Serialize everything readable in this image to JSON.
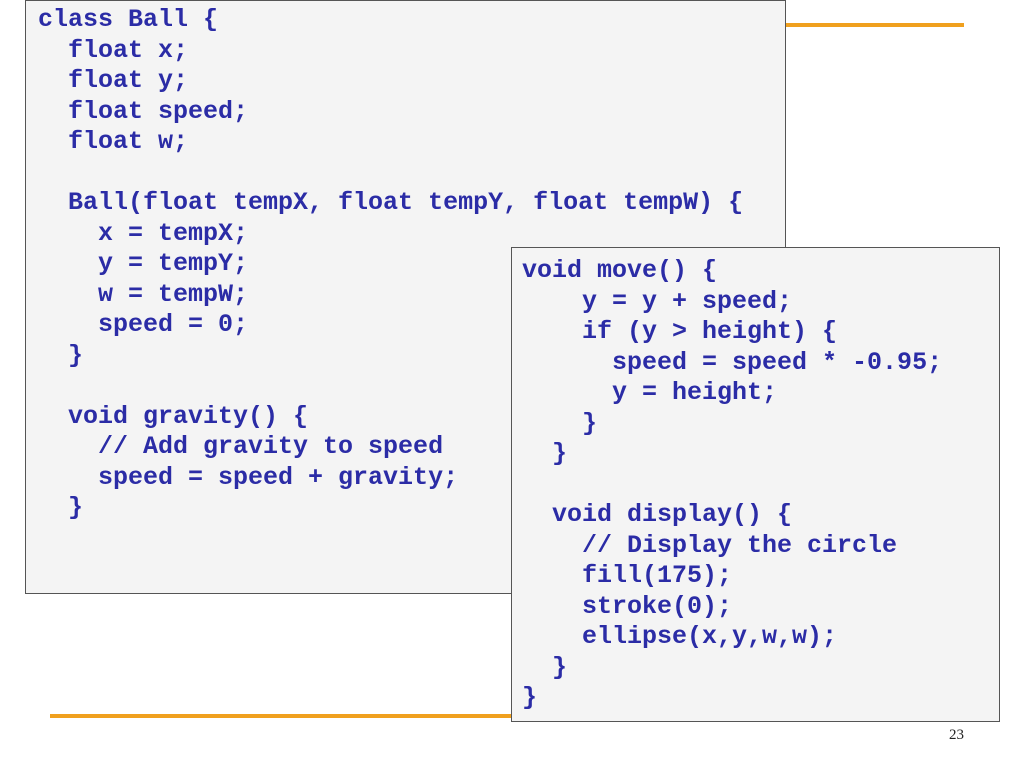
{
  "slide": {
    "page_number": "23",
    "accent_color": "#f0a01e",
    "code_color": "#2b2ca6",
    "box_background": "#f4f4f4"
  },
  "code_left": {
    "lines": [
      "class Ball {",
      "  float x;",
      "  float y;",
      "  float speed;",
      "  float w;",
      "",
      "  Ball(float tempX, float tempY, float tempW) {",
      "    x = tempX;",
      "    y = tempY;",
      "    w = tempW;",
      "    speed = 0;",
      "  }",
      "",
      "  void gravity() {",
      "    // Add gravity to speed",
      "    speed = speed + gravity;",
      "  }"
    ]
  },
  "code_right": {
    "lines": [
      "void move() {",
      "    y = y + speed;",
      "    if (y > height) {",
      "      speed = speed * -0.95;",
      "      y = height;",
      "    }",
      "  }",
      "",
      "  void display() {",
      "    // Display the circle",
      "    fill(175);",
      "    stroke(0);",
      "    ellipse(x,y,w,w);",
      "  }",
      "}"
    ]
  }
}
